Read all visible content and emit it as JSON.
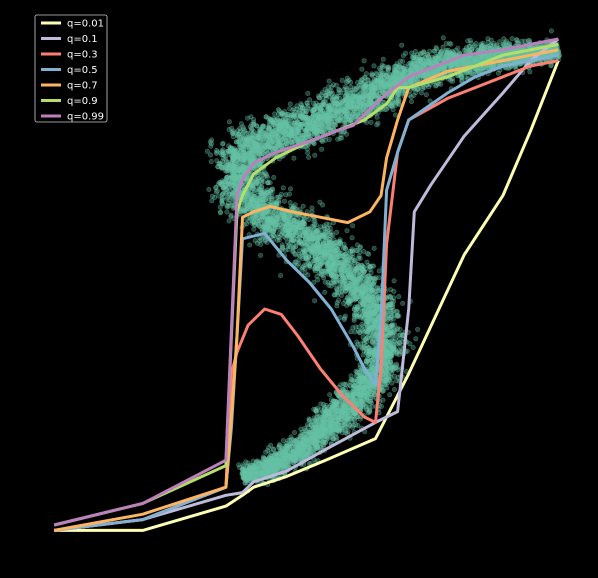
{
  "chart_data": {
    "type": "line",
    "title": "",
    "xlabel": "",
    "ylabel": "",
    "xlim": [
      0,
      100
    ],
    "ylim": [
      0,
      100
    ],
    "grid": false,
    "axes_visible": false,
    "legend_position": "upper-left",
    "background": "#000000",
    "scatter": {
      "name": "",
      "color": "#66c2a5",
      "description_points": "dense S-shaped cloud of samples",
      "centerline": [
        [
          38,
          14
        ],
        [
          44,
          16
        ],
        [
          50,
          20
        ],
        [
          56,
          26
        ],
        [
          61,
          31
        ],
        [
          64,
          36
        ],
        [
          63,
          42
        ],
        [
          60,
          48
        ],
        [
          55,
          54
        ],
        [
          47,
          60
        ],
        [
          40,
          64
        ],
        [
          36,
          70
        ],
        [
          38,
          74
        ],
        [
          43,
          77
        ],
        [
          50,
          79
        ],
        [
          56,
          82
        ],
        [
          62,
          85
        ],
        [
          68,
          88
        ],
        [
          73,
          90
        ],
        [
          79,
          91
        ],
        [
          85,
          92
        ],
        [
          90,
          92
        ],
        [
          95,
          93
        ]
      ],
      "half_width": [
        1.5,
        2,
        2.5,
        3,
        3,
        3.5,
        3.5,
        4,
        4,
        4,
        4,
        4,
        4,
        3.5,
        3.5,
        3.5,
        3.5,
        3,
        3,
        2.5,
        2,
        2,
        1.5
      ]
    },
    "series": [
      {
        "name": "q=0.01",
        "color": "#ffffb3",
        "x": [
          4,
          20,
          35,
          38,
          40,
          46,
          53,
          62,
          68,
          73,
          78,
          85,
          90,
          95
        ],
        "y": [
          4,
          4,
          8.5,
          10.5,
          12,
          14,
          17,
          21,
          33,
          44,
          55,
          66,
          78,
          91
        ]
      },
      {
        "name": "q=0.1",
        "color": "#bebada",
        "x": [
          4,
          20,
          35,
          38,
          40,
          46,
          53,
          62,
          66,
          68,
          69,
          72,
          78,
          85,
          90,
          95
        ],
        "y": [
          4,
          6,
          10.5,
          11,
          13,
          15,
          19,
          24,
          26,
          45,
          63,
          68,
          77,
          85,
          91,
          95
        ]
      },
      {
        "name": "q=0.3",
        "color": "#fb8072",
        "x": [
          4,
          20,
          35,
          36,
          37,
          39,
          42,
          45,
          48,
          52,
          56,
          60,
          62,
          63,
          64,
          66,
          68,
          75,
          80,
          85,
          90,
          95
        ],
        "y": [
          4,
          6,
          12,
          33,
          37,
          42,
          45,
          44,
          40,
          34,
          29,
          25,
          24,
          34,
          57,
          74,
          80,
          84,
          86,
          88,
          90,
          91
        ]
      },
      {
        "name": "q=0.5",
        "color": "#80b1d3",
        "x": [
          4,
          20,
          35,
          36,
          37,
          38,
          42,
          46,
          50,
          54,
          58,
          60,
          62,
          63,
          64,
          66,
          68,
          75,
          80,
          85,
          90,
          95
        ],
        "y": [
          4,
          6,
          12,
          23,
          40,
          58,
          59,
          54,
          50,
          45,
          38,
          34,
          31,
          43,
          67,
          74,
          80,
          85,
          88,
          90,
          91,
          92
        ]
      },
      {
        "name": "q=0.7",
        "color": "#fdb462",
        "x": [
          4,
          20,
          35,
          36,
          37,
          38,
          40,
          43,
          47,
          52,
          57,
          61,
          63,
          64,
          66,
          68,
          75,
          80,
          85,
          90,
          95
        ],
        "y": [
          4,
          7,
          12,
          25,
          40,
          62,
          63,
          64,
          63,
          62,
          61,
          63,
          66,
          73,
          80,
          86,
          89,
          90,
          91,
          92,
          93
        ]
      },
      {
        "name": "q=0.9",
        "color": "#b3de69",
        "x": [
          4,
          20,
          35,
          36,
          37,
          38,
          40,
          44,
          50,
          55,
          60,
          64,
          66,
          68,
          75,
          80,
          85,
          90,
          95
        ],
        "y": [
          5,
          9,
          16,
          40,
          63,
          66,
          70,
          73,
          76,
          78,
          80,
          83,
          86,
          86,
          88,
          90,
          92,
          93,
          94
        ]
      },
      {
        "name": "q=0.99",
        "color": "#bc80bd",
        "x": [
          4,
          20,
          35,
          36,
          37,
          38,
          40,
          44,
          50,
          55,
          58,
          63,
          68,
          73,
          78,
          85,
          90,
          95
        ],
        "y": [
          5,
          9,
          17,
          41,
          66,
          69,
          72,
          74,
          76,
          78,
          79,
          84,
          88,
          90,
          92,
          93,
          94,
          95
        ]
      }
    ]
  }
}
